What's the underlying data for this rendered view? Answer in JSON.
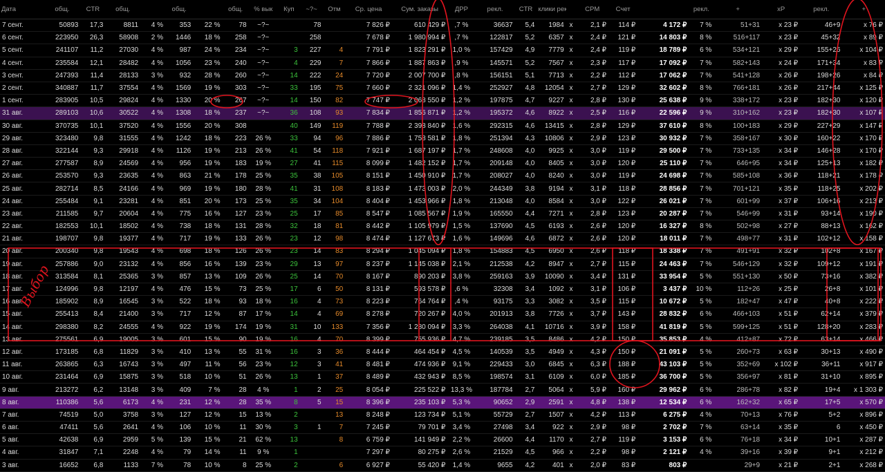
{
  "headers": [
    "Дата",
    "общ.",
    "CTR",
    "общ.",
    "",
    "общ.",
    "",
    "общ.",
    "% вык",
    "Куп",
    "~?~",
    "Отм",
    "Ср. цена",
    "Сум. заказы",
    "ДРР",
    "рекл.",
    "CTR",
    "клики рекл.",
    "",
    "CPM",
    "Счет",
    "",
    "рекл.",
    "+",
    "xP",
    "рекл.",
    "+",
    "xP"
  ],
  "header_icons": [
    "",
    "eye-icon",
    "",
    "cart-icon",
    "",
    "box-icon",
    "",
    "box-icon",
    "",
    "",
    "",
    "",
    "",
    "",
    "",
    "eye-icon",
    "",
    "hand-icon",
    "",
    "",
    "wallet-icon",
    "",
    "box-icon",
    "",
    "box-icon",
    "box-icon",
    "",
    "box-icon"
  ],
  "rows": [
    [
      "7 сент.",
      "50893",
      "17,3",
      "8811",
      "4 %",
      "353",
      "22 %",
      "78",
      "~?~",
      "",
      "78",
      "",
      "7 826 ₽",
      "610 429 ₽",
      ",7 %",
      "36637",
      "5,4",
      "1984",
      "x",
      "2,1 ₽",
      "114 ₽",
      "4 172 ₽",
      "7 %",
      "51+31",
      "x 23 ₽",
      "46+9",
      "x 76 ₽"
    ],
    [
      "6 сент.",
      "223950",
      "26,3",
      "58908",
      "2 %",
      "1446",
      "18 %",
      "258",
      "~?~",
      "",
      "258",
      "",
      "7 678 ₽",
      "1 980 994 ₽",
      ",7 %",
      "122817",
      "5,2",
      "6357",
      "x",
      "2,4 ₽",
      "121 ₽",
      "14 803 ₽",
      "8 %",
      "516+117",
      "x 23 ₽",
      "45+32",
      "x 89 ₽"
    ],
    [
      "5 сент.",
      "241107",
      "11,2",
      "27030",
      "4 %",
      "987",
      "24 %",
      "234",
      "~?~",
      "3",
      "227",
      "4",
      "7 791 ₽",
      "1 823 291 ₽",
      "1,0 %",
      "157429",
      "4,9",
      "7779",
      "x",
      "2,4 ₽",
      "119 ₽",
      "18 789 ₽",
      "6 %",
      "534+121",
      "x 29 ₽",
      "155+26",
      "x 104 ₽"
    ],
    [
      "4 сент.",
      "235584",
      "12,1",
      "28482",
      "4 %",
      "1056",
      "23 %",
      "240",
      "~?~",
      "4",
      "229",
      "7",
      "7 866 ₽",
      "1 887 863 ₽",
      ",9 %",
      "145571",
      "5,2",
      "7567",
      "x",
      "2,3 ₽",
      "117 ₽",
      "17 092 ₽",
      "7 %",
      "582+143",
      "x 24 ₽",
      "171+34",
      "x 83 ₽"
    ],
    [
      "3 сент.",
      "247393",
      "11,4",
      "28133",
      "3 %",
      "932",
      "28 %",
      "260",
      "~?~",
      "14",
      "222",
      "24",
      "7 720 ₽",
      "2 007 700 ₽",
      ",8 %",
      "156151",
      "5,1",
      "7713",
      "x",
      "2,2 ₽",
      "112 ₽",
      "17 062 ₽",
      "7 %",
      "541+128",
      "x 26 ₽",
      "198+26",
      "x 84 ₽"
    ],
    [
      "2 сент.",
      "340887",
      "11,7",
      "37554",
      "4 %",
      "1569",
      "19 %",
      "303",
      "~?~",
      "33",
      "195",
      "75",
      "7 660 ₽",
      "2 321 096 ₽",
      "1,4 %",
      "252927",
      "4,8",
      "12054",
      "x",
      "2,7 ₽",
      "129 ₽",
      "32 602 ₽",
      "8 %",
      "766+181",
      "x 26 ₽",
      "217+44",
      "x 125 ₽"
    ],
    [
      "1 сент.",
      "283905",
      "10,5",
      "29824",
      "4 %",
      "1330",
      "20 %",
      "267",
      "~?~",
      "14",
      "150",
      "82",
      "7 747 ₽",
      "2 068 550 ₽",
      "1,2 %",
      "197875",
      "4,7",
      "9227",
      "x",
      "2,8 ₽",
      "130 ₽",
      "25 638 ₽",
      "9 %",
      "338+172",
      "x 23 ₽",
      "182+30",
      "x 120 ₽"
    ],
    [
      "31 авг.",
      "289103",
      "10,6",
      "30522",
      "4 %",
      "1308",
      "18 %",
      "237",
      "~?~",
      "36",
      "108",
      "93",
      "7 834 ₽",
      "1 856 871 ₽",
      "1,2 %",
      "195372",
      "4,6",
      "8922",
      "x",
      "2,5 ₽",
      "116 ₽",
      "22 596 ₽",
      "9 %",
      "310+162",
      "x 23 ₽",
      "182+30",
      "x 107 ₽"
    ],
    [
      "30 авг.",
      "370735",
      "10,1",
      "37520",
      "4 %",
      "1556",
      "20 %",
      "308",
      "",
      "40",
      "149",
      "119",
      "7 788 ₽",
      "2 398 840 ₽",
      "1,6 %",
      "292315",
      "4,6",
      "13415",
      "x",
      "2,8 ₽",
      "129 ₽",
      "37 610 ₽",
      "8 %",
      "100+183",
      "x 29 ₽",
      "227+29",
      "x 147 ₽"
    ],
    [
      "29 авг.",
      "323480",
      "9,8",
      "31555",
      "4 %",
      "1242",
      "18 %",
      "223",
      "26 %",
      "33",
      "94",
      "96",
      "7 886 ₽",
      "1 758 581 ₽",
      "1,8 %",
      "251394",
      "4,3",
      "10806",
      "x",
      "2,9 ₽",
      "123 ₽",
      "30 932 ₽",
      "7 %",
      "358+167",
      "x 30 ₽",
      "160+22",
      "x 170 ₽"
    ],
    [
      "28 авг.",
      "322144",
      "9,3",
      "29918",
      "4 %",
      "1126",
      "19 %",
      "213",
      "26 %",
      "41",
      "54",
      "118",
      "7 921 ₽",
      "1 687 197 ₽",
      "1,7 %",
      "248608",
      "4,0",
      "9925",
      "x",
      "3,0 ₽",
      "119 ₽",
      "29 500 ₽",
      "7 %",
      "733+135",
      "x 34 ₽",
      "146+28",
      "x 170 ₽"
    ],
    [
      "27 авг.",
      "277587",
      "8,9",
      "24569",
      "4 %",
      "956",
      "19 %",
      "183",
      "19 %",
      "27",
      "41",
      "115",
      "8 099 ₽",
      "1 482 152 ₽",
      "1,7 %",
      "209148",
      "4,0",
      "8405",
      "x",
      "3,0 ₽",
      "120 ₽",
      "25 110 ₽",
      "7 %",
      "646+95",
      "x 34 ₽",
      "125+13",
      "x 182 ₽"
    ],
    [
      "26 авг.",
      "253570",
      "9,3",
      "23635",
      "4 %",
      "863",
      "21 %",
      "178",
      "25 %",
      "35",
      "38",
      "105",
      "8 151 ₽",
      "1 450 910 ₽",
      "1,7 %",
      "208027",
      "4,0",
      "8240",
      "x",
      "3,0 ₽",
      "119 ₽",
      "24 698 ₽",
      "7 %",
      "585+108",
      "x 36 ₽",
      "118+21",
      "x 178 ₽"
    ],
    [
      "25 авг.",
      "282714",
      "8,5",
      "24166",
      "4 %",
      "969",
      "19 %",
      "180",
      "28 %",
      "41",
      "31",
      "108",
      "8 183 ₽",
      "1 473 003 ₽",
      "2,0 %",
      "244349",
      "3,8",
      "9194",
      "x",
      "3,1 ₽",
      "118 ₽",
      "28 856 ₽",
      "7 %",
      "701+121",
      "x 35 ₽",
      "118+25",
      "x 202 ₽"
    ],
    [
      "24 авг.",
      "255484",
      "9,1",
      "23281",
      "4 %",
      "851",
      "20 %",
      "173",
      "25 %",
      "35",
      "34",
      "104",
      "8 404 ₽",
      "1 453 966 ₽",
      "1,8 %",
      "213048",
      "4,0",
      "8584",
      "x",
      "3,0 ₽",
      "122 ₽",
      "26 021 ₽",
      "7 %",
      "601+99",
      "x 37 ₽",
      "106+16",
      "x 213 ₽"
    ],
    [
      "23 авг.",
      "211585",
      "9,7",
      "20604",
      "4 %",
      "775",
      "16 %",
      "127",
      "23 %",
      "25",
      "17",
      "85",
      "8 547 ₽",
      "1 085 567 ₽",
      "1,9 %",
      "165550",
      "4,4",
      "7271",
      "x",
      "2,8 ₽",
      "123 ₽",
      "20 287 ₽",
      "7 %",
      "546+99",
      "x 31 ₽",
      "93+14",
      "x 190 ₽"
    ],
    [
      "22 авг.",
      "182553",
      "10,1",
      "18502",
      "4 %",
      "738",
      "18 %",
      "131",
      "28 %",
      "32",
      "18",
      "81",
      "8 442 ₽",
      "1 105 979 ₽",
      "1,5 %",
      "137690",
      "4,5",
      "6193",
      "x",
      "2,6 ₽",
      "120 ₽",
      "16 327 ₽",
      "8 %",
      "502+98",
      "x 27 ₽",
      "88+13",
      "x 162 ₽"
    ],
    [
      "21 авг.",
      "198707",
      "9,8",
      "19377",
      "4 %",
      "717",
      "19 %",
      "133",
      "26 %",
      "23",
      "12",
      "98",
      "8 474 ₽",
      "1 127 673 ₽",
      "1,6 %",
      "149696",
      "4,6",
      "6872",
      "x",
      "2,6 ₽",
      "120 ₽",
      "18 011 ₽",
      "7 %",
      "498+77",
      "x 31 ₽",
      "102+12",
      "x 158 ₽"
    ],
    [
      "20 авг.",
      "200340",
      "9,8",
      "19543",
      "4 %",
      "698",
      "18 %",
      "126",
      "26 %",
      "23",
      "14",
      "83",
      "8 294 ₽",
      "1 045 094 ₽",
      "1,8 %",
      "154883",
      "4,5",
      "6950",
      "x",
      "2,6 ₽",
      "118 ₽",
      "18 338 ₽",
      "7 %",
      "491+91",
      "x 32 ₽",
      "102+8",
      "x 167 ₽"
    ],
    [
      "19 авг.",
      "257886",
      "9,0",
      "23132",
      "4 %",
      "856",
      "16 %",
      "139",
      "23 %",
      "29",
      "13",
      "97",
      "8 237 ₽",
      "1 145 038 ₽",
      "2,1 %",
      "212538",
      "4,2",
      "8947",
      "x",
      "2,7 ₽",
      "115 ₽",
      "24 463 ₽",
      "7 %",
      "546+129",
      "x 32 ₽",
      "109+12",
      "x 191 ₽"
    ],
    [
      "18 авг.",
      "313584",
      "8,1",
      "25365",
      "3 %",
      "857",
      "13 %",
      "109",
      "26 %",
      "25",
      "14",
      "70",
      "8 167 ₽",
      "890 203 ₽",
      "3,8 %",
      "259163",
      "3,9",
      "10090",
      "x",
      "3,4 ₽",
      "131 ₽",
      "33 954 ₽",
      "5 %",
      "551+130",
      "x 50 ₽",
      "73+16",
      "x 382 ₽"
    ],
    [
      "17 авг.",
      "124996",
      "9,8",
      "12197",
      "4 %",
      "476",
      "15 %",
      "73",
      "25 %",
      "17",
      "6",
      "50",
      "8 131 ₽",
      "593 578 ₽",
      ",6 %",
      "32308",
      "3,4",
      "1092",
      "x",
      "3,1 ₽",
      "106 ₽",
      "3 437 ₽",
      "10 %",
      "112+26",
      "x 25 ₽",
      "26+8",
      "x 101 ₽"
    ],
    [
      "16 авг.",
      "185902",
      "8,9",
      "16545",
      "3 %",
      "522",
      "18 %",
      "93",
      "18 %",
      "16",
      "4",
      "73",
      "8 223 ₽",
      "764 764 ₽",
      ",4 %",
      "93175",
      "3,3",
      "3082",
      "x",
      "3,5 ₽",
      "115 ₽",
      "10 672 ₽",
      "5 %",
      "182+47",
      "x 47 ₽",
      "40+8",
      "x 222 ₽"
    ],
    [
      "15 авг.",
      "255413",
      "8,4",
      "21400",
      "3 %",
      "717",
      "12 %",
      "87",
      "17 %",
      "14",
      "4",
      "69",
      "8 278 ₽",
      "720 267 ₽",
      "4,0 %",
      "201913",
      "3,8",
      "7726",
      "x",
      "3,7 ₽",
      "143 ₽",
      "28 832 ₽",
      "6 %",
      "466+103",
      "x 51 ₽",
      "62+14",
      "x 379 ₽"
    ],
    [
      "14 авг.",
      "298380",
      "8,2",
      "24555",
      "4 %",
      "922",
      "19 %",
      "174",
      "19 %",
      "31",
      "10",
      "133",
      "7 356 ₽",
      "1 280 094 ₽",
      "3,3 %",
      "264038",
      "4,1",
      "10716",
      "x",
      "3,9 ₽",
      "158 ₽",
      "41 819 ₽",
      "5 %",
      "599+125",
      "x 51 ₽",
      "128+20",
      "x 283 ₽"
    ],
    [
      "13 авг.",
      "275561",
      "6,9",
      "19005",
      "3 %",
      "601",
      "15 %",
      "90",
      "19 %",
      "16",
      "4",
      "70",
      "8 399 ₽",
      "755 936 ₽",
      "4,7 %",
      "239185",
      "3,5",
      "8486",
      "x",
      "4,2 ₽",
      "150 ₽",
      "35 853 ₽",
      "4 %",
      "412+87",
      "x 72 ₽",
      "63+14",
      "x 466 ₽"
    ],
    [
      "12 авг.",
      "173185",
      "6,8",
      "11829",
      "3 %",
      "410",
      "13 %",
      "55",
      "31 %",
      "16",
      "3",
      "36",
      "8 444 ₽",
      "464 454 ₽",
      "4,5 %",
      "140539",
      "3,5",
      "4949",
      "x",
      "4,3 ₽",
      "150 ₽",
      "21 091 ₽",
      "5 %",
      "260+73",
      "x 63 ₽",
      "30+13",
      "x 490 ₽"
    ],
    [
      "11 авг.",
      "263865",
      "6,3",
      "16743",
      "3 %",
      "497",
      "11 %",
      "56",
      "23 %",
      "12",
      "3",
      "41",
      "8 481 ₽",
      "474 936 ₽",
      "9,1 %",
      "229433",
      "3,0",
      "6845",
      "x",
      "6,3 ₽",
      "188 ₽",
      "43 103 ₽",
      "5 %",
      "352+69",
      "x 102 ₽",
      "36+11",
      "x 917 ₽"
    ],
    [
      "10 авг.",
      "231464",
      "6,9",
      "15875",
      "3 %",
      "518",
      "10 %",
      "51",
      "26 %",
      "13",
      "1",
      "37",
      "8 489 ₽",
      "432 943 ₽",
      "8,5 %",
      "198574",
      "3,1",
      "6109",
      "x",
      "6,0 ₽",
      "185 ₽",
      "36 700 ₽",
      "5 %",
      "356+97",
      "x 81 ₽",
      "31+10",
      "x 895 ₽"
    ],
    [
      "9 авг.",
      "213272",
      "6,2",
      "13148",
      "3 %",
      "409",
      "7 %",
      "28",
      "4 %",
      "1",
      "2",
      "25",
      "8 054 ₽",
      "225 522 ₽",
      "13,3 %",
      "187784",
      "2,7",
      "5064",
      "x",
      "5,9 ₽",
      "160 ₽",
      "29 962 ₽",
      "6 %",
      "286+78",
      "x 82 ₽",
      "19+4",
      "x 1 303 ₽"
    ],
    [
      "8 авг.",
      "110386",
      "5,6",
      "6173",
      "4 %",
      "231",
      "12 %",
      "28",
      "35 %",
      "8",
      "5",
      "15",
      "8 396 ₽",
      "235 103 ₽",
      "5,3 %",
      "90652",
      "2,9",
      "2591",
      "x",
      "4,8 ₽",
      "138 ₽",
      "12 534 ₽",
      "6 %",
      "162+32",
      "x 65 ₽",
      "17+5",
      "x 570 ₽"
    ],
    [
      "7 авг.",
      "74519",
      "5,0",
      "3758",
      "3 %",
      "127",
      "12 %",
      "15",
      "13 %",
      "2",
      "",
      "13",
      "8 248 ₽",
      "123 734 ₽",
      "5,1 %",
      "55729",
      "2,7",
      "1507",
      "x",
      "4,2 ₽",
      "113 ₽",
      "6 275 ₽",
      "4 %",
      "70+13",
      "x 76 ₽",
      "5+2",
      "x 896 ₽"
    ],
    [
      "6 авг.",
      "47411",
      "5,6",
      "2641",
      "4 %",
      "106",
      "10 %",
      "11",
      "30 %",
      "3",
      "1",
      "7",
      "7 245 ₽",
      "79 701 ₽",
      "3,4 %",
      "27498",
      "3,4",
      "922",
      "x",
      "2,9 ₽",
      "98 ₽",
      "2 702 ₽",
      "7 %",
      "63+14",
      "x 35 ₽",
      "6",
      "x 450 ₽"
    ],
    [
      "5 авг.",
      "42638",
      "6,9",
      "2959",
      "5 %",
      "139",
      "15 %",
      "21",
      "62 %",
      "13",
      "",
      "8",
      "6 759 ₽",
      "141 949 ₽",
      "2,2 %",
      "26600",
      "4,4",
      "1170",
      "x",
      "2,7 ₽",
      "119 ₽",
      "3 153 ₽",
      "6 %",
      "76+18",
      "x 34 ₽",
      "10+1",
      "x 287 ₽"
    ],
    [
      "4 авг.",
      "31847",
      "7,1",
      "2248",
      "4 %",
      "79",
      "14 %",
      "11",
      "9 %",
      "1",
      "",
      "",
      "7 297 ₽",
      "80 275 ₽",
      "2,6 %",
      "21529",
      "4,5",
      "966",
      "x",
      "2,2 ₽",
      "98 ₽",
      "2 121 ₽",
      "4 %",
      "39+16",
      "x 39 ₽",
      "9+1",
      "x 212 ₽"
    ],
    [
      "3 авг.",
      "16652",
      "6,8",
      "1133",
      "7 %",
      "78",
      "10 %",
      "8",
      "25 %",
      "2",
      "",
      "6",
      "6 927 ₽",
      "55 420 ₽",
      "1,4 %",
      "9655",
      "4,2",
      "401",
      "x",
      "2,0 ₽",
      "83 ₽",
      "803 ₽",
      "",
      "29+9",
      "x 21 ₽",
      "2+1",
      "x 268 ₽"
    ]
  ],
  "annotation": "Выбор"
}
